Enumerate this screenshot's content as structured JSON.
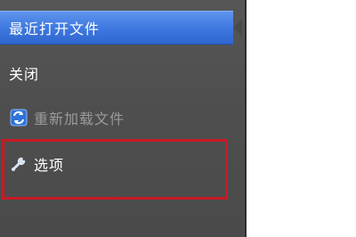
{
  "menu": {
    "items": [
      {
        "label": "最近打开文件",
        "state": "selected"
      },
      {
        "label": "关闭",
        "state": "normal"
      },
      {
        "label": "重新加载文件",
        "state": "disabled",
        "icon": "reload-icon"
      },
      {
        "label": "选项",
        "state": "normal",
        "icon": "wrench-icon"
      }
    ]
  },
  "colors": {
    "panel_background": "#4f4f4f",
    "selected_background": "#3f79e0",
    "text": "#ffffff",
    "disabled_text": "#9b9b9b",
    "highlight_border": "#c61b26"
  }
}
